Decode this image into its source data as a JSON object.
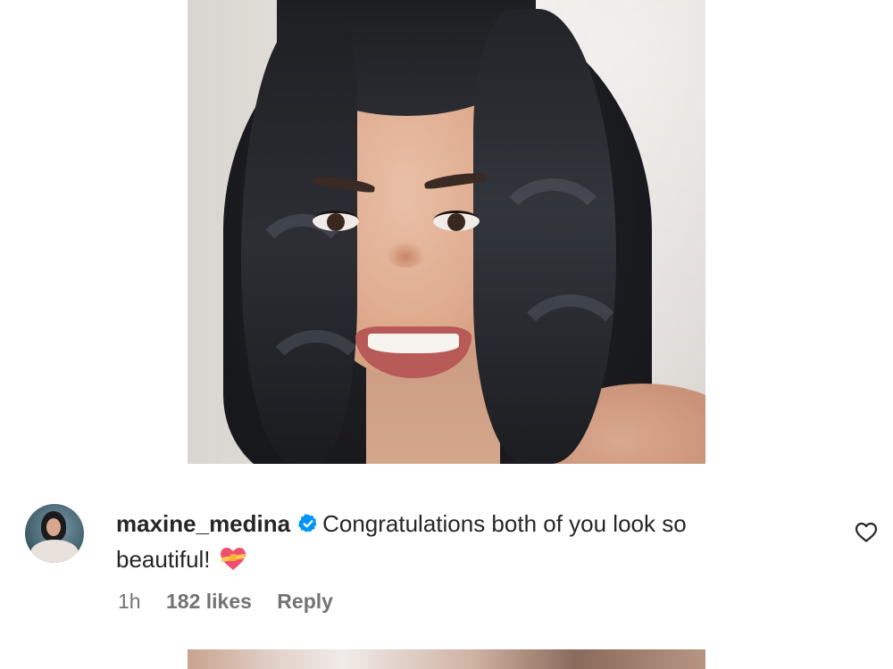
{
  "comment": {
    "username": "maxine_medina",
    "text_line1": "Congratulations both of you look so",
    "text_line2": "beautiful!",
    "time": "1h",
    "likes": "182 likes",
    "reply_label": "Reply"
  },
  "icons": {
    "verified": "verified-badge-icon",
    "emoji": "heart-with-ribbon-emoji",
    "like": "heart-outline-icon"
  },
  "colors": {
    "verified_blue": "#0095f6",
    "text_primary": "#262626",
    "text_secondary": "#737373",
    "emoji_pink": "#f0506e"
  }
}
